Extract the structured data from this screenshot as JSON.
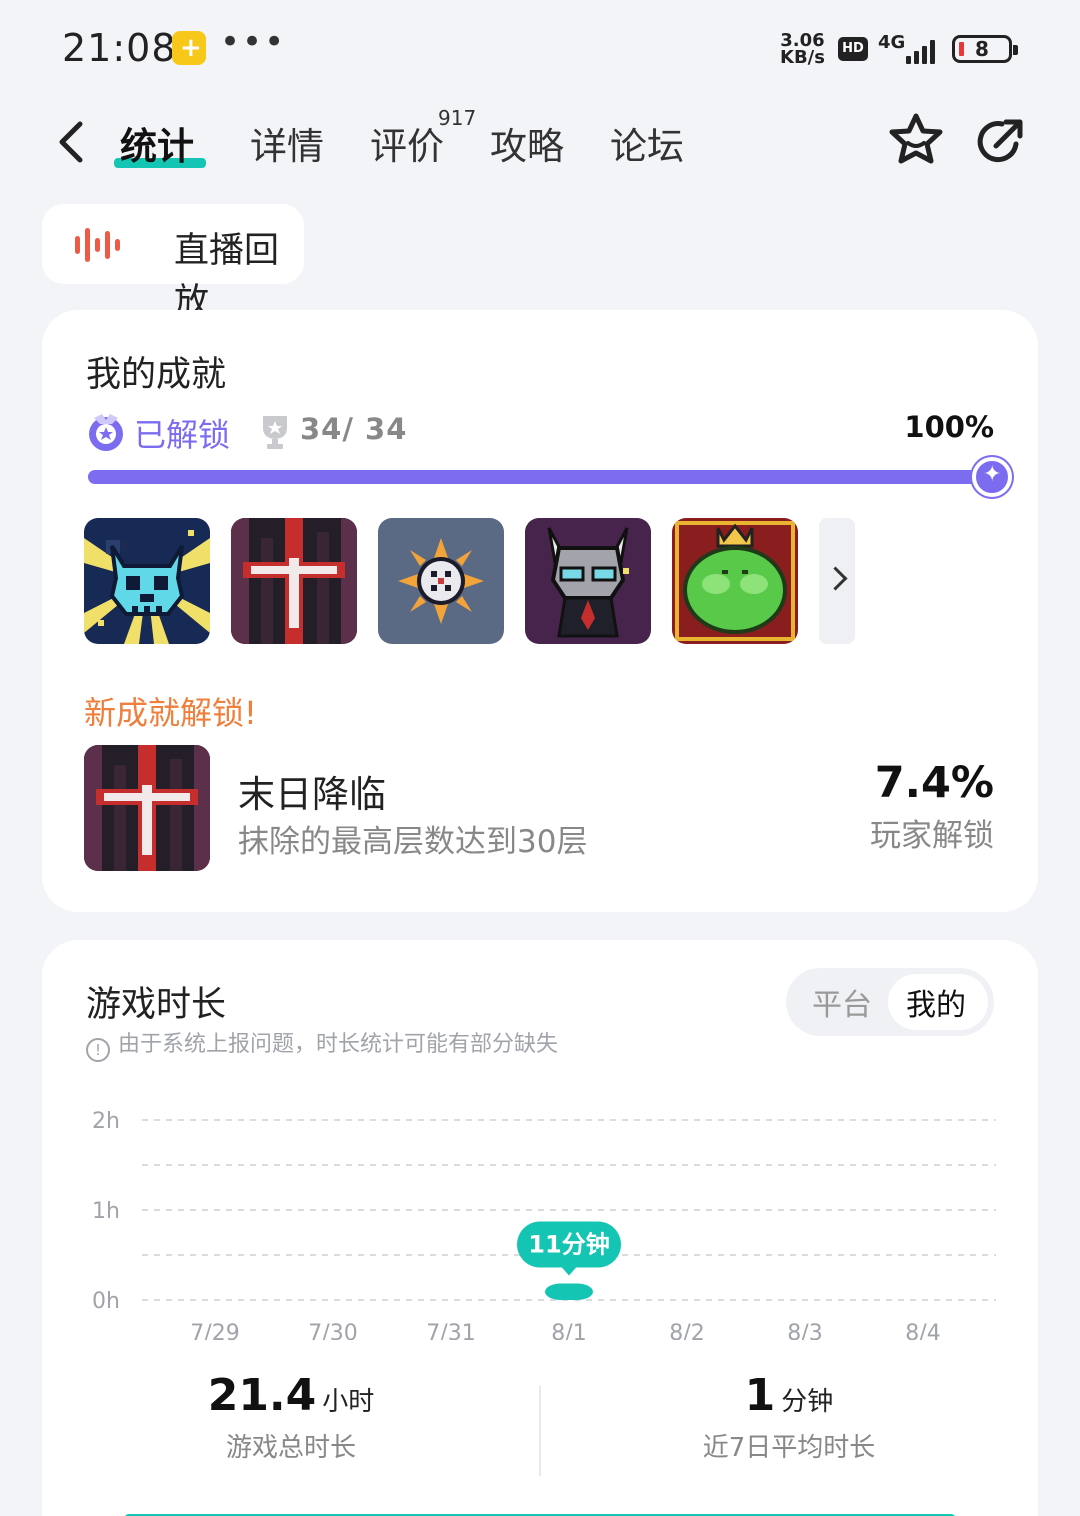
{
  "status_bar": {
    "time": "21:08",
    "net_speed": "3.06\nKB/s",
    "hd": "HD",
    "network": "4G",
    "battery": "8"
  },
  "nav": {
    "tabs": [
      {
        "label": "统计",
        "active": true
      },
      {
        "label": "详情"
      },
      {
        "label": "评价"
      },
      {
        "label": "攻略"
      },
      {
        "label": "论坛"
      }
    ],
    "review_count": "917"
  },
  "replay": {
    "label": "直播回放"
  },
  "achievements": {
    "title": "我的成就",
    "unlocked_label": "已解锁",
    "count": "34/ 34",
    "percent": "100%",
    "progress": 1.0,
    "new_label": "新成就解锁!",
    "new_achievement": {
      "name": "末日降临",
      "desc": "抹除的最高层数达到30层",
      "rate": "7.4%",
      "rate_label": "玩家解锁"
    }
  },
  "playtime": {
    "title": "游戏时长",
    "notice": "由于系统上报问题，时长统计可能有部分缺失",
    "segment": {
      "platform": "平台",
      "mine": "我的"
    },
    "total_value": "21.4",
    "total_unit": "小时",
    "total_label": "游戏总时长",
    "avg_value": "1",
    "avg_unit": "分钟",
    "avg_label": "近7日平均时长"
  },
  "chart_data": {
    "type": "bar",
    "categories": [
      "7/29",
      "7/30",
      "7/31",
      "8/1",
      "8/2",
      "8/3",
      "8/4"
    ],
    "values": [
      0,
      0,
      0,
      11,
      0,
      0,
      0
    ],
    "unit": "minutes",
    "y_ticks": [
      "0h",
      "1h",
      "2h"
    ],
    "ylim": [
      0,
      120
    ],
    "highlight_label": "11分钟",
    "highlight_index": 3,
    "grid": true,
    "bar_color": "#15c5b3"
  },
  "colors": {
    "accent": "#15c5b3",
    "purple": "#7b6cf0",
    "orange": "#ee7f3c"
  }
}
